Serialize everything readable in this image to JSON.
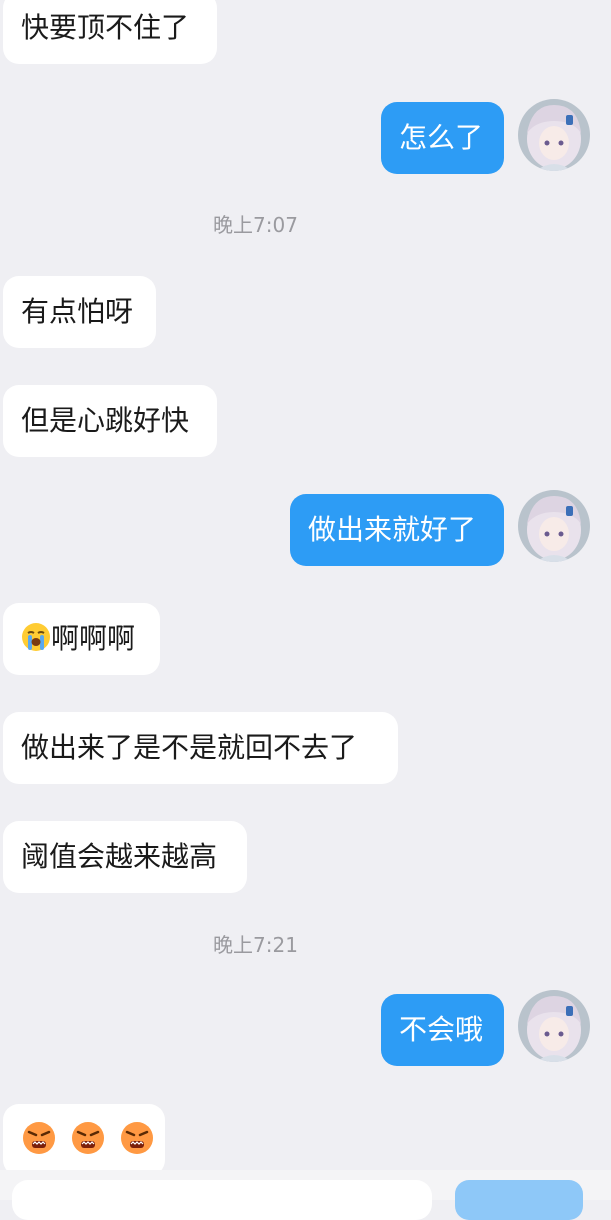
{
  "messages": [
    {
      "side": "in",
      "text": "快要顶不住了"
    },
    {
      "side": "out",
      "text": "怎么了"
    },
    {
      "side": "in",
      "text": "有点怕呀"
    },
    {
      "side": "in",
      "text": "但是心跳好快"
    },
    {
      "side": "out",
      "text": "做出来就好了"
    },
    {
      "side": "in",
      "text": "啊啊啊",
      "emoji": "loudly-crying-face"
    },
    {
      "side": "in",
      "text": "做出来了是不是就回不去了"
    },
    {
      "side": "in",
      "text": "阈值会越来越高"
    },
    {
      "side": "out",
      "text": "不会哦"
    },
    {
      "side": "in",
      "emoji": "angry-face-x3"
    }
  ],
  "timestamps": [
    "晚上7:07",
    "晚上7:21"
  ],
  "colors": {
    "background": "#efeff3",
    "incoming_bubble": "#ffffff",
    "outgoing_bubble": "#2d9cf5",
    "timestamp_text": "#9a9a9f"
  }
}
